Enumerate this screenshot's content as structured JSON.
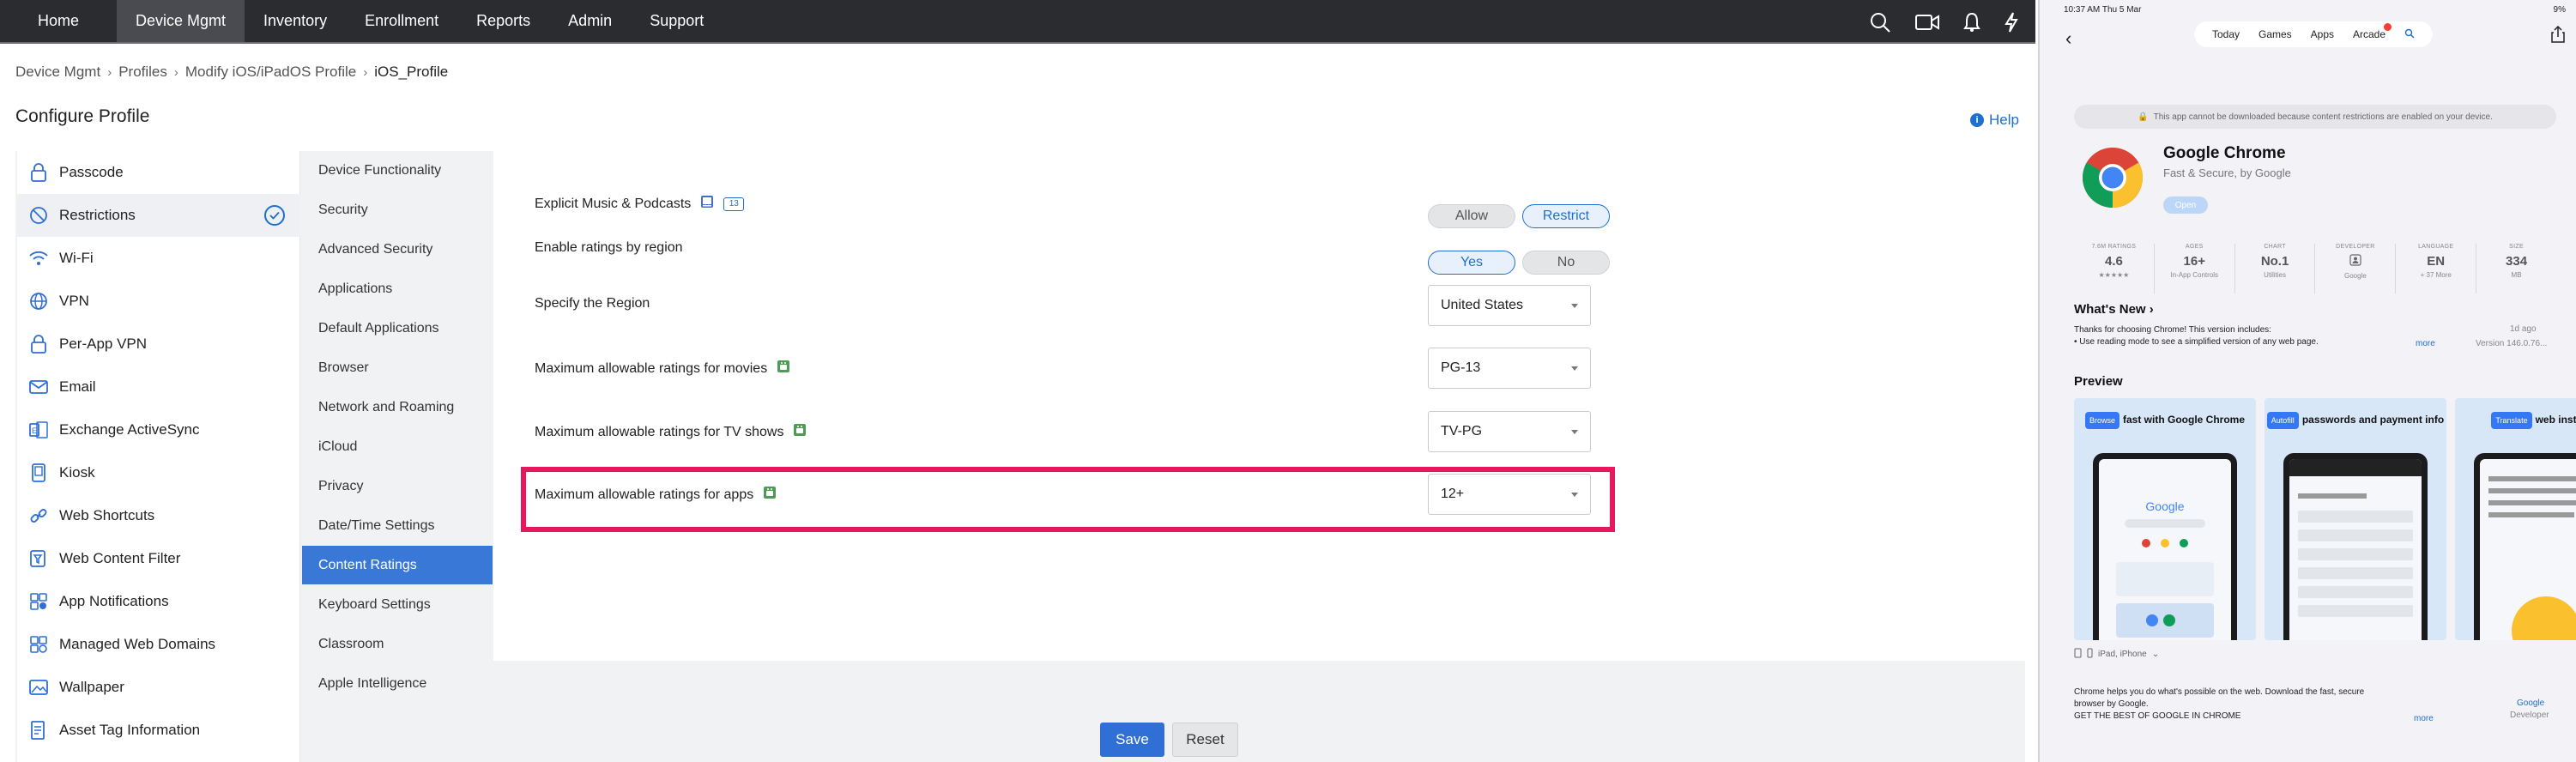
{
  "topnav": {
    "items": [
      "Home",
      "Device Mgmt",
      "Inventory",
      "Enrollment",
      "Reports",
      "Admin",
      "Support"
    ],
    "active_index": 1
  },
  "breadcrumb": [
    "Device Mgmt",
    "Profiles",
    "Modify iOS/iPadOS Profile",
    "iOS_Profile"
  ],
  "page": {
    "title": "Configure Profile",
    "help": "Help"
  },
  "sidebar": {
    "items": [
      {
        "label": "Passcode",
        "icon": "lock-icon"
      },
      {
        "label": "Restrictions",
        "icon": "prohibited-icon",
        "active": true,
        "checked": true
      },
      {
        "label": "Wi-Fi",
        "icon": "wifi-icon"
      },
      {
        "label": "VPN",
        "icon": "globe-icon"
      },
      {
        "label": "Per-App VPN",
        "icon": "lock-icon"
      },
      {
        "label": "Email",
        "icon": "envelope-icon"
      },
      {
        "label": "Exchange ActiveSync",
        "icon": "exchange-icon"
      },
      {
        "label": "Kiosk",
        "icon": "kiosk-icon"
      },
      {
        "label": "Web Shortcuts",
        "icon": "link-icon"
      },
      {
        "label": "Web Content Filter",
        "icon": "filter-icon"
      },
      {
        "label": "App Notifications",
        "icon": "notification-icon"
      },
      {
        "label": "Managed Web Domains",
        "icon": "domains-icon"
      },
      {
        "label": "Wallpaper",
        "icon": "image-icon"
      },
      {
        "label": "Asset Tag Information",
        "icon": "tag-icon"
      }
    ]
  },
  "subnav": {
    "items": [
      "Device Functionality",
      "Security",
      "Advanced Security",
      "Applications",
      "Default Applications",
      "Browser",
      "Network and Roaming",
      "iCloud",
      "Privacy",
      "Date/Time Settings",
      "Content Ratings",
      "Keyboard Settings",
      "Classroom",
      "Apple Intelligence"
    ],
    "active_index": 10
  },
  "content": {
    "explicit": {
      "label": "Explicit Music & Podcasts",
      "badge": "13",
      "opt_allow": "Allow",
      "opt_restrict": "Restrict",
      "selected": "Restrict"
    },
    "ratings_region": {
      "label": "Enable ratings by region",
      "opt_yes": "Yes",
      "opt_no": "No",
      "selected": "Yes"
    },
    "region": {
      "label": "Specify the Region",
      "value": "United States"
    },
    "movies": {
      "label": "Maximum allowable ratings for movies",
      "value": "PG-13"
    },
    "tv": {
      "label": "Maximum allowable ratings for TV shows",
      "value": "TV-PG"
    },
    "apps": {
      "label": "Maximum allowable ratings for apps",
      "value": "12+"
    }
  },
  "actions": {
    "save": "Save",
    "reset": "Reset"
  },
  "colors": {
    "accent": "#1d6fd1",
    "highlight": "#e8185f",
    "nav_bg": "#2b2c30"
  },
  "store": {
    "status_time": "10:37 AM  Thu 5 Mar",
    "status_right": "9%",
    "tabs": [
      "Today",
      "Games",
      "Apps",
      "Arcade"
    ],
    "notice": "This app cannot be downloaded because content restrictions are enabled on your device.",
    "app_name": "Google Chrome",
    "app_sub": "Fast & Secure, by Google",
    "open_label": "Open",
    "info": [
      {
        "h": "7.6M RATINGS",
        "v": "4.6",
        "s": "★★★★★"
      },
      {
        "h": "AGES",
        "v": "16+",
        "s": "In-App Controls"
      },
      {
        "h": "CHART",
        "v": "No.1",
        "s": "Utilities"
      },
      {
        "h": "DEVELOPER",
        "v": "",
        "s": "Google"
      },
      {
        "h": "LANGUAGE",
        "v": "EN",
        "s": "+ 37 More"
      },
      {
        "h": "SIZE",
        "v": "334",
        "s": "MB"
      }
    ],
    "whats_new": {
      "title": "What's New",
      "line1": "Thanks for choosing Chrome! This version includes:",
      "line2": "• Use reading mode to see a simplified version of any web page.",
      "more": "more",
      "date": "1d ago",
      "version": "Version 146.0.76..."
    },
    "preview": {
      "title": "Preview",
      "shots": [
        {
          "chip": "Browse",
          "caption": "fast with Google Chrome"
        },
        {
          "chip": "Autofill",
          "caption": "passwords and payment info"
        },
        {
          "chip": "Translate",
          "caption": "web instantly"
        }
      ],
      "devices": "iPad, iPhone"
    },
    "description": {
      "line1": "Chrome helps you do what's possible on the web. Download the fast, secure",
      "line2": "browser by Google.",
      "line3": "GET THE BEST OF GOOGLE IN CHROME",
      "more": "more",
      "dev_name": "Google",
      "dev_role": "Developer"
    }
  }
}
